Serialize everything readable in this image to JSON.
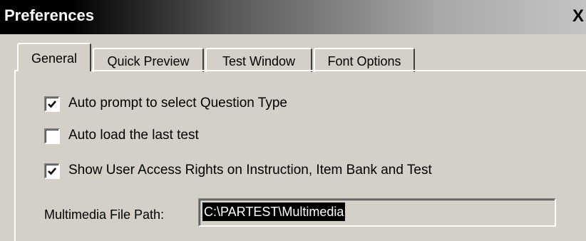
{
  "window": {
    "title": "Preferences",
    "close_label": "X"
  },
  "tabs": [
    {
      "label": "General",
      "active": true
    },
    {
      "label": "Quick Preview",
      "active": false
    },
    {
      "label": "Test Window",
      "active": false
    },
    {
      "label": "Font Options",
      "active": false
    }
  ],
  "general": {
    "options": [
      {
        "label": "Auto prompt to select Question Type",
        "checked": true
      },
      {
        "label": "Auto load the last test",
        "checked": false
      },
      {
        "label": "Show User Access Rights on Instruction, Item Bank and Test",
        "checked": true
      }
    ],
    "multimedia_path": {
      "label": "Multimedia File Path:",
      "value": "C:\\PARTEST\\Multimedia"
    }
  },
  "colors": {
    "dialog_bg": "#d4d0c8",
    "title_text": "#ffffff",
    "selection_bg": "#000000"
  }
}
